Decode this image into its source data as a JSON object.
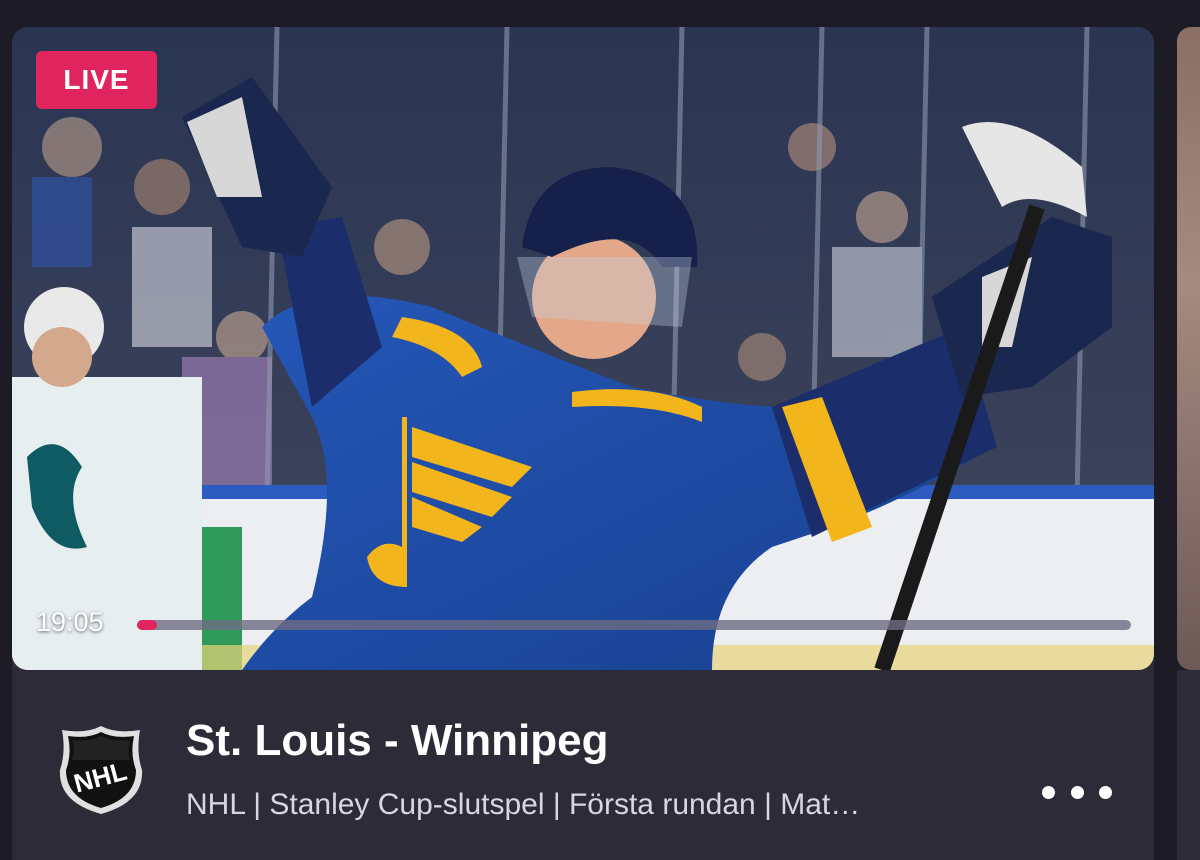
{
  "card": {
    "live_label": "LIVE",
    "time": "19:05",
    "progress_fraction": 0.02,
    "title": "St. Louis - Winnipeg",
    "subtitle": "NHL | Stanley Cup-slutspel | Första rundan | Mat…",
    "league_logo_text": "NHL",
    "thumbnail_icon": "hockey-player-celebration-image",
    "more_icon": "more-horizontal-icon"
  },
  "colors": {
    "live": "#e0245e",
    "background": "#1c1b26",
    "card": "#2c2b37",
    "jersey_blue": "#1f4fa8",
    "jersey_gold": "#f2b51c"
  }
}
